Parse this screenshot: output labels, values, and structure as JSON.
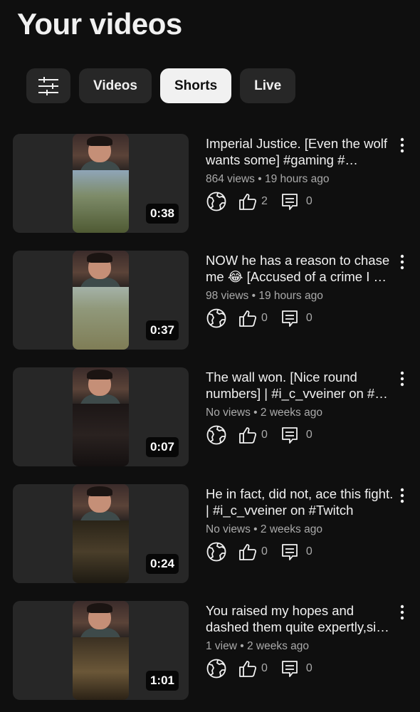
{
  "page": {
    "title": "Your videos"
  },
  "chips": [
    {
      "label": "",
      "icon": "sliders-icon"
    },
    {
      "label": "Videos"
    },
    {
      "label": "Shorts",
      "active": true
    },
    {
      "label": "Live"
    }
  ],
  "videos": [
    {
      "title": "Imperial Justice. [Even the wolf wants some] #gaming #…",
      "meta": "864 views • 19 hours ago",
      "duration": "0:38",
      "likes": "2",
      "comments": "0"
    },
    {
      "title": "NOW he has a reason to chase me 😂 [Accused of a crime I …",
      "meta": "98 views • 19 hours ago",
      "duration": "0:37",
      "likes": "0",
      "comments": "0"
    },
    {
      "title": "The wall won. [Nice round numbers] | #i_c_vveiner on #…",
      "meta": "No views • 2 weeks ago",
      "duration": "0:07",
      "likes": "0",
      "comments": "0"
    },
    {
      "title": "He in fact, did not, ace this fight. | #i_c_vveiner on #Twitch",
      "meta": "No views • 2 weeks ago",
      "duration": "0:24",
      "likes": "0",
      "comments": "0"
    },
    {
      "title": "You raised my hopes and dashed them quite expertly,si…",
      "meta": "1 view • 2 weeks ago",
      "duration": "1:01",
      "likes": "0",
      "comments": "0"
    }
  ],
  "colors": {
    "background": "#0f0f0f",
    "chip": "#272727",
    "chip_active": "#f1f1f1",
    "text": "#f1f1f1",
    "secondary": "#aaaaaa"
  }
}
